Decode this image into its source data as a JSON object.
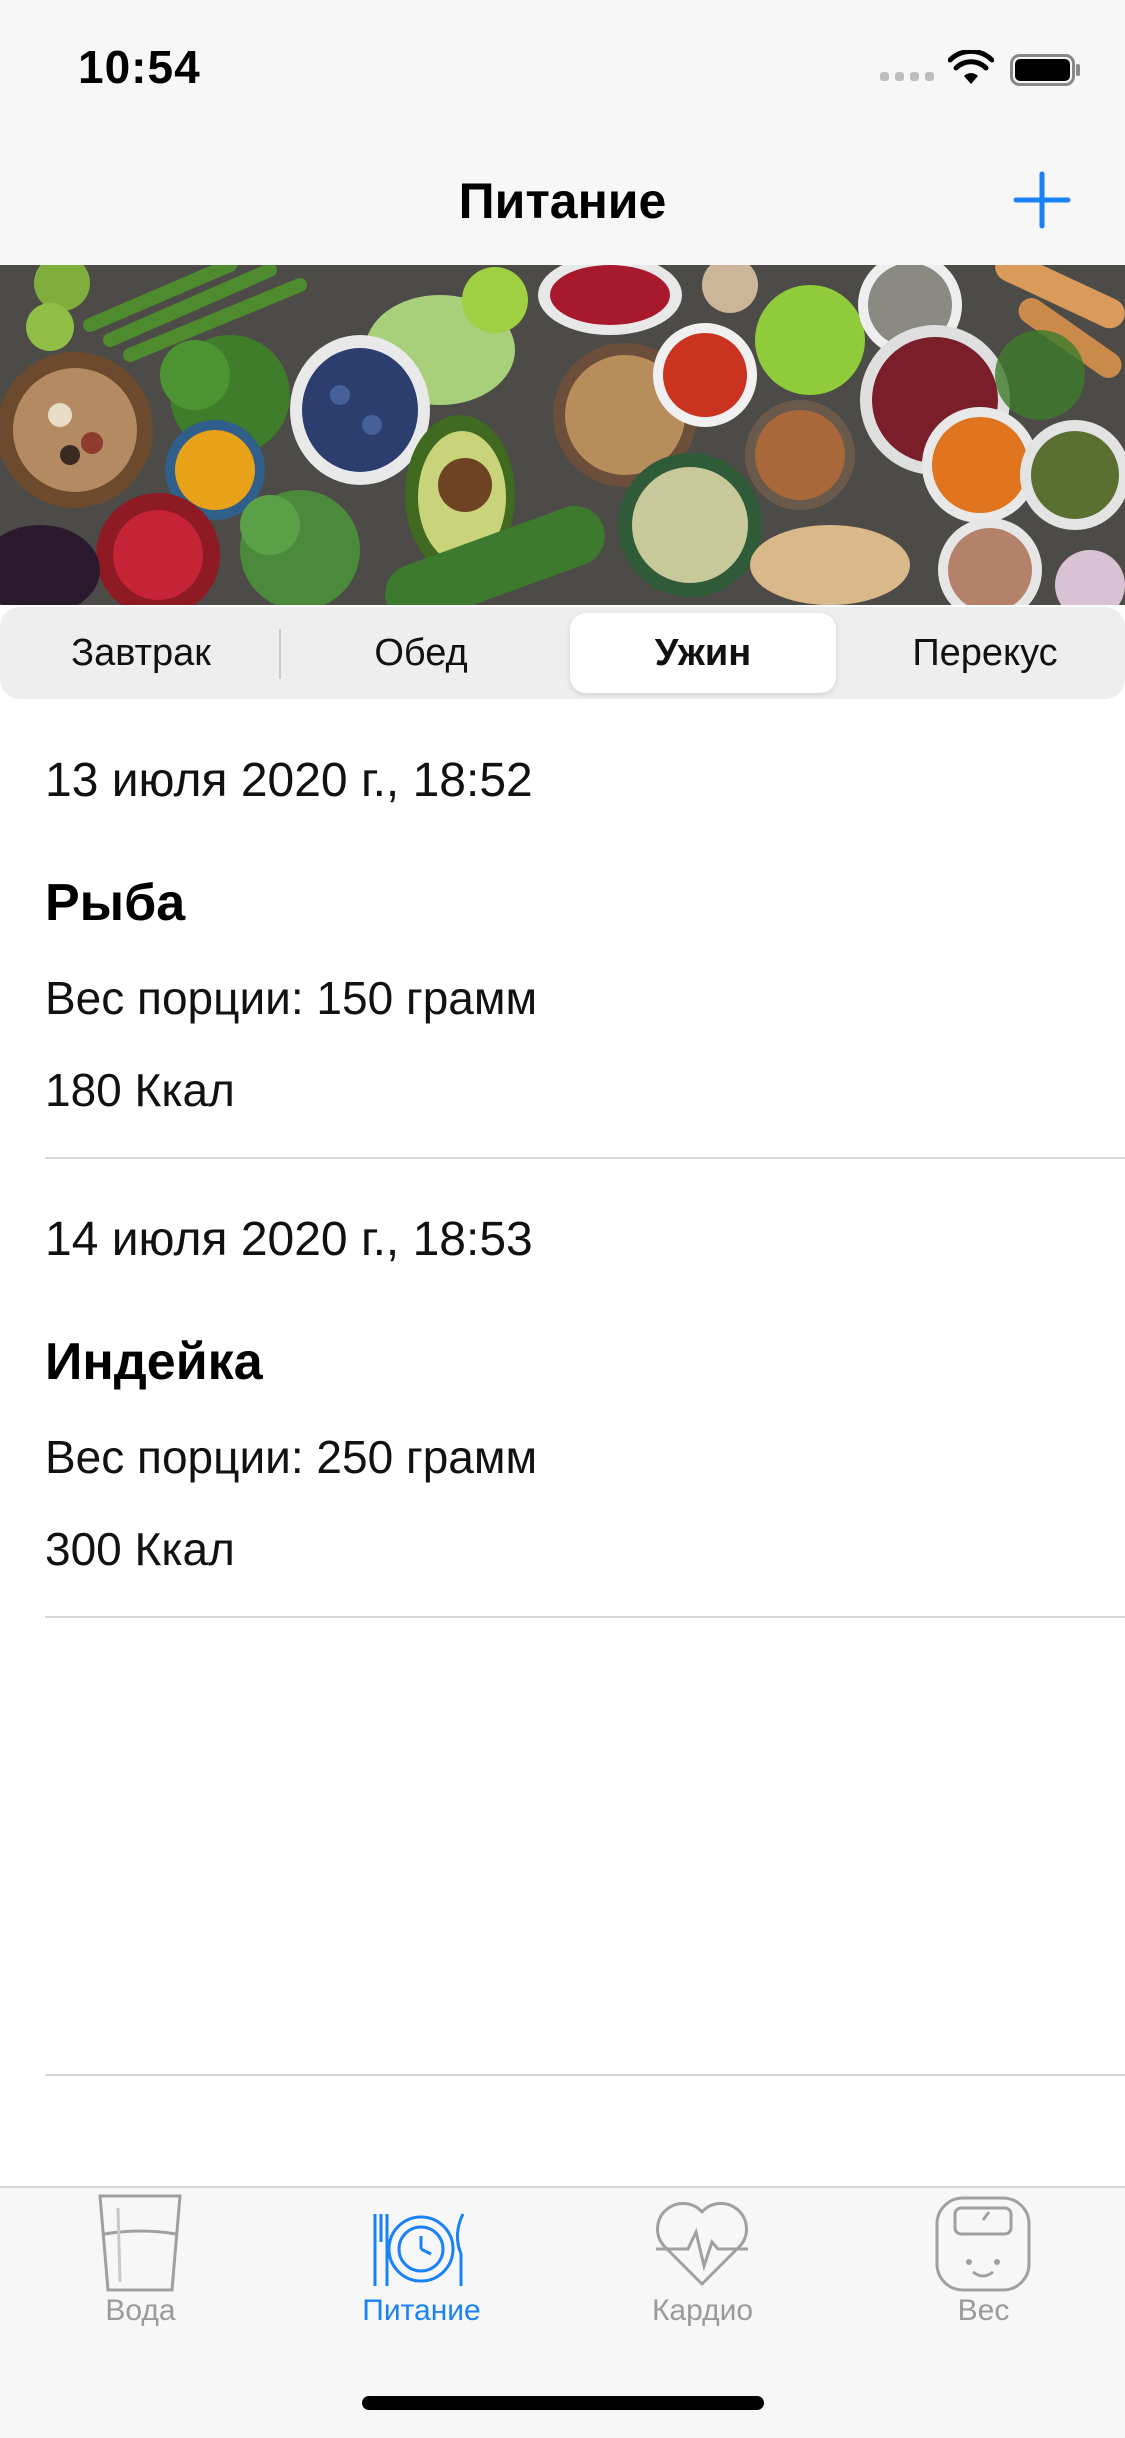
{
  "status_bar": {
    "time": "10:54"
  },
  "nav": {
    "title": "Питание",
    "add_icon": "plus-icon",
    "accent_color": "#1a82f7"
  },
  "segments": [
    {
      "label": "Завтрак"
    },
    {
      "label": "Обед"
    },
    {
      "label": "Ужин",
      "selected": true
    },
    {
      "label": "Перекус"
    }
  ],
  "entries": [
    {
      "date": "13 июля 2020 г., 18:52",
      "name": "Рыба",
      "weight": "Вес порции: 150 грамм",
      "kcal": "180 Ккал"
    },
    {
      "date": "14 июля 2020 г., 18:53",
      "name": "Индейка",
      "weight": "Вес порции: 250 грамм",
      "kcal": "300 Ккал"
    }
  ],
  "tabs": [
    {
      "label": "Вода",
      "icon": "water-glass-icon"
    },
    {
      "label": "Питание",
      "icon": "plate-icon",
      "active": true
    },
    {
      "label": "Кардио",
      "icon": "heart-pulse-icon"
    },
    {
      "label": "Вес",
      "icon": "scale-icon"
    }
  ]
}
